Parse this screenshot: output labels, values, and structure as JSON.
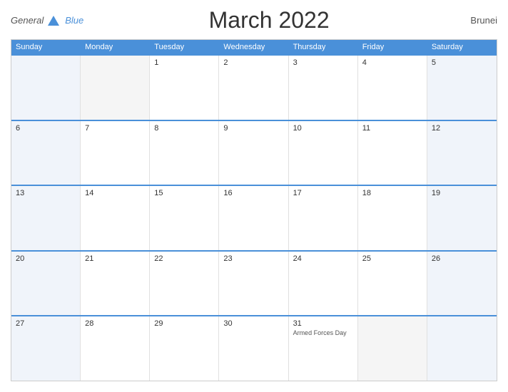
{
  "header": {
    "logo": {
      "general": "General",
      "blue": "Blue"
    },
    "title": "March 2022",
    "country": "Brunei"
  },
  "dayHeaders": [
    "Sunday",
    "Monday",
    "Tuesday",
    "Wednesday",
    "Thursday",
    "Friday",
    "Saturday"
  ],
  "weeks": [
    [
      {
        "date": "",
        "empty": true
      },
      {
        "date": "",
        "empty": true
      },
      {
        "date": "1"
      },
      {
        "date": "2"
      },
      {
        "date": "3"
      },
      {
        "date": "4"
      },
      {
        "date": "5"
      }
    ],
    [
      {
        "date": "6"
      },
      {
        "date": "7"
      },
      {
        "date": "8"
      },
      {
        "date": "9"
      },
      {
        "date": "10"
      },
      {
        "date": "11"
      },
      {
        "date": "12"
      }
    ],
    [
      {
        "date": "13"
      },
      {
        "date": "14"
      },
      {
        "date": "15"
      },
      {
        "date": "16"
      },
      {
        "date": "17"
      },
      {
        "date": "18"
      },
      {
        "date": "19"
      }
    ],
    [
      {
        "date": "20"
      },
      {
        "date": "21"
      },
      {
        "date": "22"
      },
      {
        "date": "23"
      },
      {
        "date": "24"
      },
      {
        "date": "25"
      },
      {
        "date": "26"
      }
    ],
    [
      {
        "date": "27"
      },
      {
        "date": "28"
      },
      {
        "date": "29"
      },
      {
        "date": "30"
      },
      {
        "date": "31",
        "event": "Armed Forces Day"
      },
      {
        "date": "",
        "empty": true
      },
      {
        "date": "",
        "empty": true
      }
    ]
  ]
}
